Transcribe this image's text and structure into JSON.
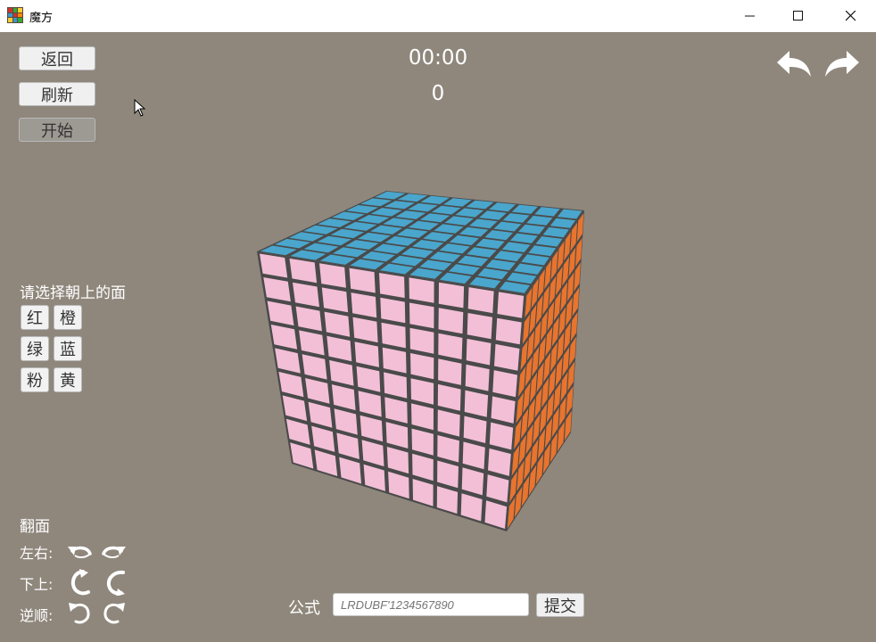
{
  "window": {
    "title": "魔方",
    "minimize_glyph": "—",
    "maximize_glyph": "☐",
    "close_glyph": "✕"
  },
  "controls": {
    "back_label": "返回",
    "refresh_label": "刷新",
    "start_label": "开始"
  },
  "hud": {
    "timer": "00:00",
    "move_count": "0"
  },
  "history": {
    "undo_icon": "undo-arrow-icon",
    "redo_icon": "redo-arrow-icon"
  },
  "face_select": {
    "prompt": "请选择朝上的面",
    "options": [
      "红",
      "橙",
      "绿",
      "蓝",
      "粉",
      "黄"
    ]
  },
  "flip": {
    "title": "翻面",
    "left_right_label": "左右:",
    "down_up_label": "下上:",
    "ccw_cw_label": "逆顺:"
  },
  "formula": {
    "label": "公式",
    "placeholder": "LRDUBF'1234567890",
    "submit_label": "提交"
  },
  "cube": {
    "size": 9,
    "top_color": "#4aa6cc",
    "front_color": "#f2bfd6",
    "right_color": "#e8742e",
    "edge_color": "#4a4a4a"
  },
  "colors": {
    "background": "#8f877c",
    "titlebar": "#ffffff",
    "text_light": "#ffffff"
  }
}
